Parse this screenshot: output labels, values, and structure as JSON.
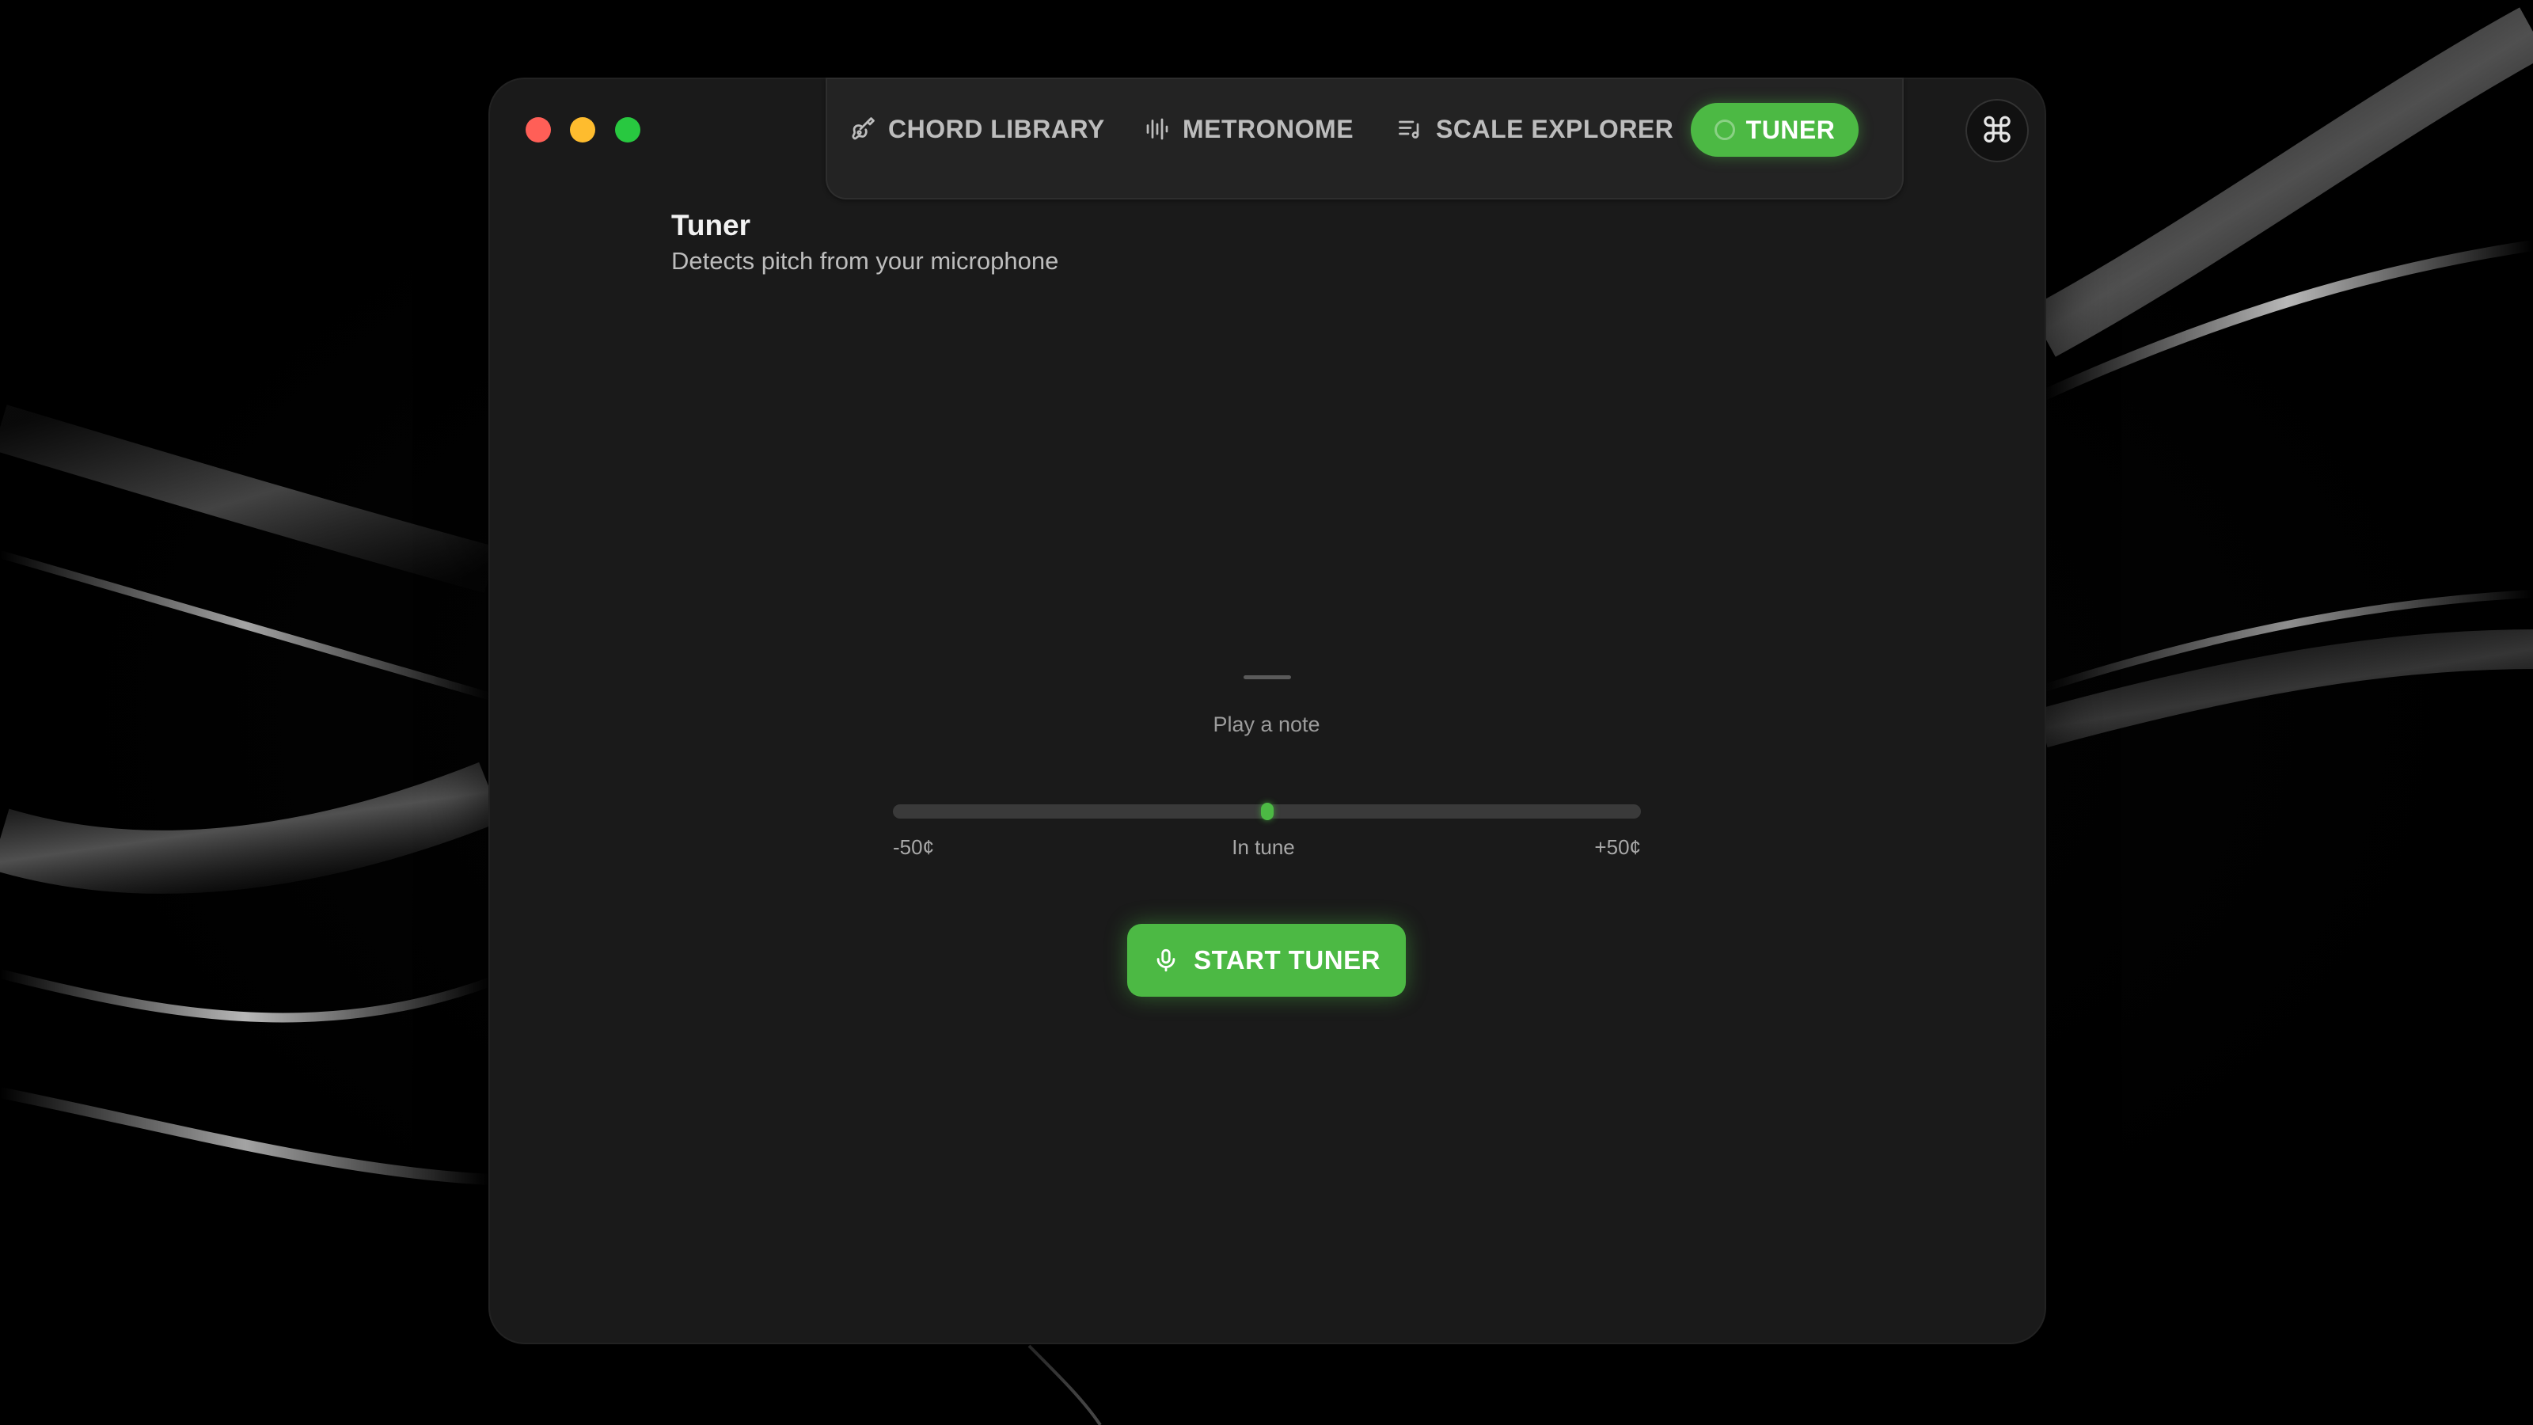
{
  "window": {
    "controls": [
      "close",
      "minimize",
      "maximize"
    ]
  },
  "nav": {
    "items": [
      {
        "label": "CHORD LIBRARY",
        "icon": "guitar-icon"
      },
      {
        "label": "METRONOME",
        "icon": "waveform-icon"
      },
      {
        "label": "SCALE EXPLORER",
        "icon": "scale-list-icon"
      },
      {
        "label": "TUNER",
        "icon": "tuner-icon",
        "active": true
      }
    ],
    "command_symbol": "⌘"
  },
  "page": {
    "title": "Tuner",
    "subtitle": "Detects pitch from your microphone"
  },
  "tuner": {
    "note_display": "—",
    "hint": "Play a note",
    "cents_offset": 0,
    "cents_range": [
      -50,
      50
    ],
    "scale_min_label": "-50¢",
    "scale_mid_label": "In tune",
    "scale_max_label": "+50¢",
    "start_label": "START TUNER"
  },
  "colors": {
    "accent": "#4cb944",
    "window_bg": "#1a1a1a",
    "close": "#ff5f57",
    "minimize": "#febc2e",
    "maximize": "#28c840"
  }
}
